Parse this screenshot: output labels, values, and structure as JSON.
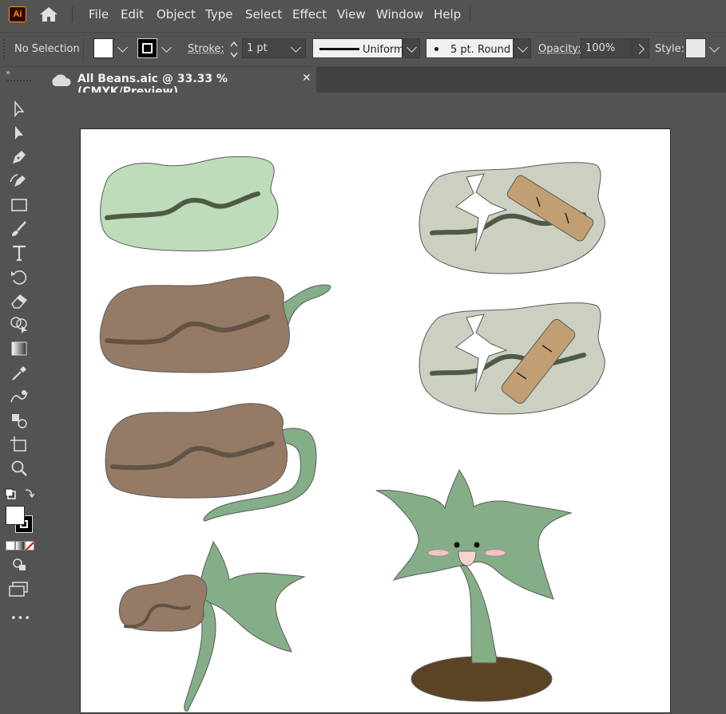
{
  "app": {
    "logo_text": "Ai",
    "accent_color": "#ff9a00"
  },
  "menu": {
    "items": [
      "File",
      "Edit",
      "Object",
      "Type",
      "Select",
      "Effect",
      "View",
      "Window",
      "Help"
    ]
  },
  "control_bar": {
    "selection_label": "No Selection",
    "stroke_label": "Stroke:",
    "stroke_value": "1 pt",
    "profile_label": "Uniform",
    "brush_label": "5 pt. Round",
    "opacity_label": "Opacity:",
    "opacity_value": "100%",
    "style_label": "Style:"
  },
  "toolbar": {
    "tools": [
      "selection-tool",
      "direct-selection-tool",
      "pen-tool",
      "curvature-tool",
      "rectangle-tool",
      "paintbrush-tool",
      "type-tool",
      "rotate-tool",
      "eraser-tool",
      "shape-builder-tool",
      "gradient-tool",
      "eyedropper-tool",
      "blend-tool",
      "symbol-sprayer-tool",
      "artboard-tool",
      "zoom-tool"
    ],
    "more_label": "•••"
  },
  "document": {
    "tab_title": "All Beans.aic @ 33.33 % (CMYK/Preview)",
    "close_glyph": "✕"
  },
  "colors": {
    "bean_light_green": "#bedcb9",
    "bean_brown": "#957a66",
    "bean_gray_green": "#cbd0c0",
    "sprout_green": "#84ae87",
    "soil": "#5a4424",
    "bandage": "#c29f72",
    "seam_dark": "#4d5a44",
    "seam_brown": "#615445"
  }
}
